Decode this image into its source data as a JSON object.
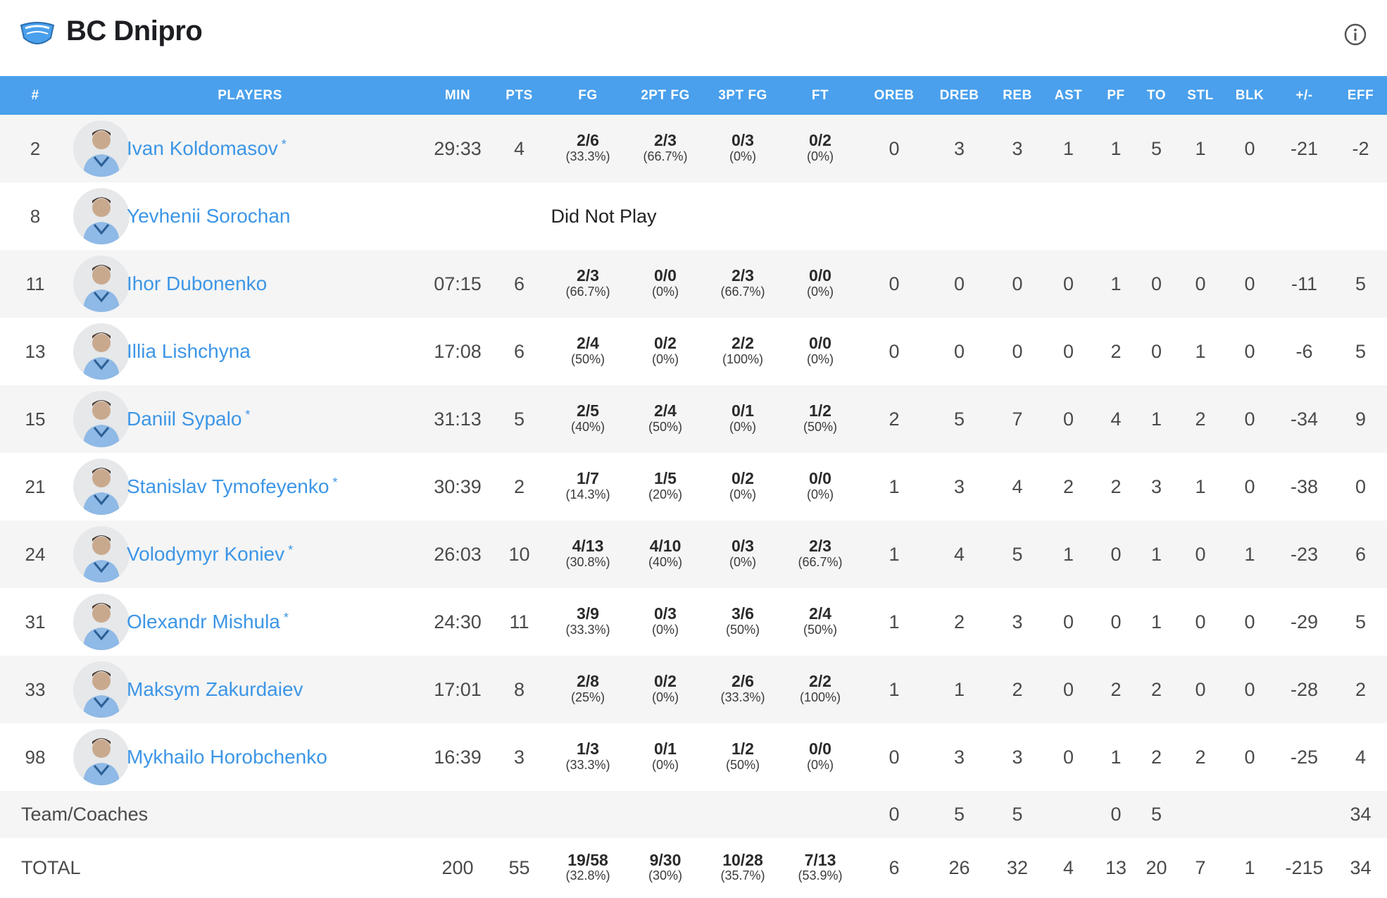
{
  "team": {
    "name": "BC Dnipro",
    "logo_icon": "bc-dnipro-logo"
  },
  "colors": {
    "header_bar": "#4aa0ec",
    "player_link": "#3d96e6"
  },
  "columns": [
    "#",
    "PLAYERS",
    "MIN",
    "PTS",
    "FG",
    "2PT FG",
    "3PT FG",
    "FT",
    "OREB",
    "DREB",
    "REB",
    "AST",
    "PF",
    "TO",
    "STL",
    "BLK",
    "+/-",
    "EFF"
  ],
  "players": [
    {
      "no": "2",
      "name": "Ivan Koldomasov",
      "starter": true,
      "min": "29:33",
      "pts": "4",
      "fg": "2/6",
      "fg_pct": "(33.3%)",
      "p2": "2/3",
      "p2_pct": "(66.7%)",
      "p3": "0/3",
      "p3_pct": "(0%)",
      "ft": "0/2",
      "ft_pct": "(0%)",
      "oreb": "0",
      "dreb": "3",
      "reb": "3",
      "ast": "1",
      "pf": "1",
      "to": "5",
      "stl": "1",
      "blk": "0",
      "pm": "-21",
      "eff": "-2"
    },
    {
      "no": "8",
      "name": "Yevhenii Sorochan",
      "starter": false,
      "dnp": "Did Not Play"
    },
    {
      "no": "11",
      "name": "Ihor Dubonenko",
      "starter": false,
      "min": "07:15",
      "pts": "6",
      "fg": "2/3",
      "fg_pct": "(66.7%)",
      "p2": "0/0",
      "p2_pct": "(0%)",
      "p3": "2/3",
      "p3_pct": "(66.7%)",
      "ft": "0/0",
      "ft_pct": "(0%)",
      "oreb": "0",
      "dreb": "0",
      "reb": "0",
      "ast": "0",
      "pf": "1",
      "to": "0",
      "stl": "0",
      "blk": "0",
      "pm": "-11",
      "eff": "5"
    },
    {
      "no": "13",
      "name": "Illia Lishchyna",
      "starter": false,
      "min": "17:08",
      "pts": "6",
      "fg": "2/4",
      "fg_pct": "(50%)",
      "p2": "0/2",
      "p2_pct": "(0%)",
      "p3": "2/2",
      "p3_pct": "(100%)",
      "ft": "0/0",
      "ft_pct": "(0%)",
      "oreb": "0",
      "dreb": "0",
      "reb": "0",
      "ast": "0",
      "pf": "2",
      "to": "0",
      "stl": "1",
      "blk": "0",
      "pm": "-6",
      "eff": "5"
    },
    {
      "no": "15",
      "name": "Daniil Sypalo",
      "starter": true,
      "min": "31:13",
      "pts": "5",
      "fg": "2/5",
      "fg_pct": "(40%)",
      "p2": "2/4",
      "p2_pct": "(50%)",
      "p3": "0/1",
      "p3_pct": "(0%)",
      "ft": "1/2",
      "ft_pct": "(50%)",
      "oreb": "2",
      "dreb": "5",
      "reb": "7",
      "ast": "0",
      "pf": "4",
      "to": "1",
      "stl": "2",
      "blk": "0",
      "pm": "-34",
      "eff": "9"
    },
    {
      "no": "21",
      "name": "Stanislav Tymofeyenko",
      "starter": true,
      "min": "30:39",
      "pts": "2",
      "fg": "1/7",
      "fg_pct": "(14.3%)",
      "p2": "1/5",
      "p2_pct": "(20%)",
      "p3": "0/2",
      "p3_pct": "(0%)",
      "ft": "0/0",
      "ft_pct": "(0%)",
      "oreb": "1",
      "dreb": "3",
      "reb": "4",
      "ast": "2",
      "pf": "2",
      "to": "3",
      "stl": "1",
      "blk": "0",
      "pm": "-38",
      "eff": "0"
    },
    {
      "no": "24",
      "name": "Volodymyr Koniev",
      "starter": true,
      "min": "26:03",
      "pts": "10",
      "fg": "4/13",
      "fg_pct": "(30.8%)",
      "p2": "4/10",
      "p2_pct": "(40%)",
      "p3": "0/3",
      "p3_pct": "(0%)",
      "ft": "2/3",
      "ft_pct": "(66.7%)",
      "oreb": "1",
      "dreb": "4",
      "reb": "5",
      "ast": "1",
      "pf": "0",
      "to": "1",
      "stl": "0",
      "blk": "1",
      "pm": "-23",
      "eff": "6"
    },
    {
      "no": "31",
      "name": "Olexandr Mishula",
      "starter": true,
      "min": "24:30",
      "pts": "11",
      "fg": "3/9",
      "fg_pct": "(33.3%)",
      "p2": "0/3",
      "p2_pct": "(0%)",
      "p3": "3/6",
      "p3_pct": "(50%)",
      "ft": "2/4",
      "ft_pct": "(50%)",
      "oreb": "1",
      "dreb": "2",
      "reb": "3",
      "ast": "0",
      "pf": "0",
      "to": "1",
      "stl": "0",
      "blk": "0",
      "pm": "-29",
      "eff": "5"
    },
    {
      "no": "33",
      "name": "Maksym Zakurdaiev",
      "starter": false,
      "min": "17:01",
      "pts": "8",
      "fg": "2/8",
      "fg_pct": "(25%)",
      "p2": "0/2",
      "p2_pct": "(0%)",
      "p3": "2/6",
      "p3_pct": "(33.3%)",
      "ft": "2/2",
      "ft_pct": "(100%)",
      "oreb": "1",
      "dreb": "1",
      "reb": "2",
      "ast": "0",
      "pf": "2",
      "to": "2",
      "stl": "0",
      "blk": "0",
      "pm": "-28",
      "eff": "2"
    },
    {
      "no": "98",
      "name": "Mykhailo Horobchenko",
      "starter": false,
      "min": "16:39",
      "pts": "3",
      "fg": "1/3",
      "fg_pct": "(33.3%)",
      "p2": "0/1",
      "p2_pct": "(0%)",
      "p3": "1/2",
      "p3_pct": "(50%)",
      "ft": "0/0",
      "ft_pct": "(0%)",
      "oreb": "0",
      "dreb": "3",
      "reb": "3",
      "ast": "0",
      "pf": "1",
      "to": "2",
      "stl": "2",
      "blk": "0",
      "pm": "-25",
      "eff": "4"
    }
  ],
  "team_coaches": {
    "label": "Team/Coaches",
    "oreb": "0",
    "dreb": "5",
    "reb": "5",
    "ast": "",
    "pf": "0",
    "to": "5",
    "stl": "",
    "blk": "",
    "pm": "",
    "eff": "34"
  },
  "total": {
    "label": "TOTAL",
    "min": "200",
    "pts": "55",
    "fg": "19/58",
    "fg_pct": "(32.8%)",
    "p2": "9/30",
    "p2_pct": "(30%)",
    "p3": "10/28",
    "p3_pct": "(35.7%)",
    "ft": "7/13",
    "ft_pct": "(53.9%)",
    "oreb": "6",
    "dreb": "26",
    "reb": "32",
    "ast": "4",
    "pf": "13",
    "to": "20",
    "stl": "7",
    "blk": "1",
    "pm": "-215",
    "eff": "34"
  }
}
